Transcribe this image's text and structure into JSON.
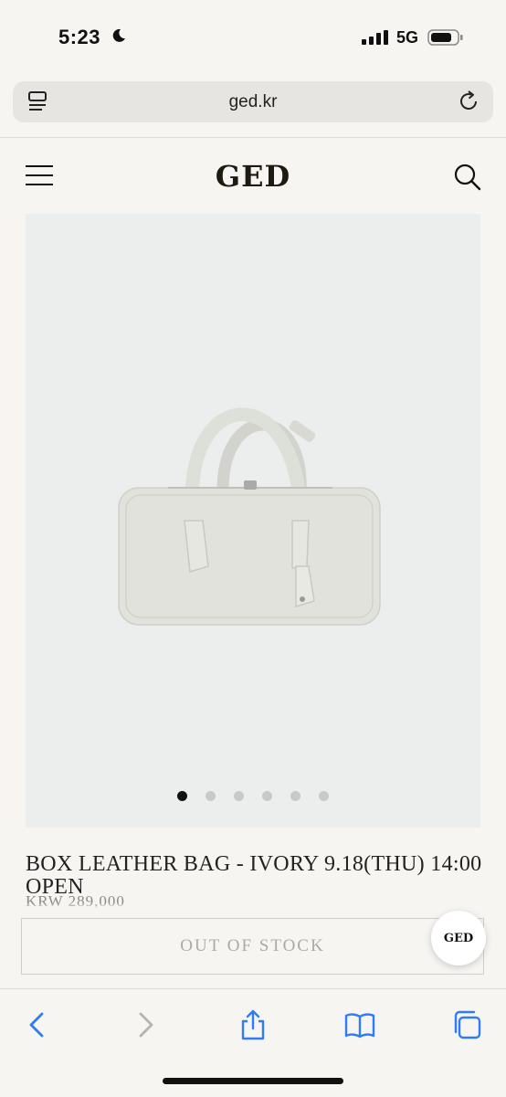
{
  "status_bar": {
    "time": "5:23",
    "network": "5G"
  },
  "browser": {
    "url": "ged.kr"
  },
  "site": {
    "logo": "GED",
    "chat_badge": "GED"
  },
  "product": {
    "title": "BOX LEATHER BAG - IVORY 9.18(THU) 14:00 OPEN",
    "price": "KRW 289,000",
    "stock_status": "OUT OF STOCK",
    "image_count": 6,
    "active_image_index": 1
  },
  "colors": {
    "background": "#f6f5f2",
    "image_background": "#eceeee",
    "logo": "#1e1a10",
    "ios_blue": "#2f7cf6"
  },
  "toolbar": {
    "icons": [
      "back-icon",
      "forward-icon",
      "share-icon",
      "bookmarks-icon",
      "tabs-icon"
    ]
  }
}
